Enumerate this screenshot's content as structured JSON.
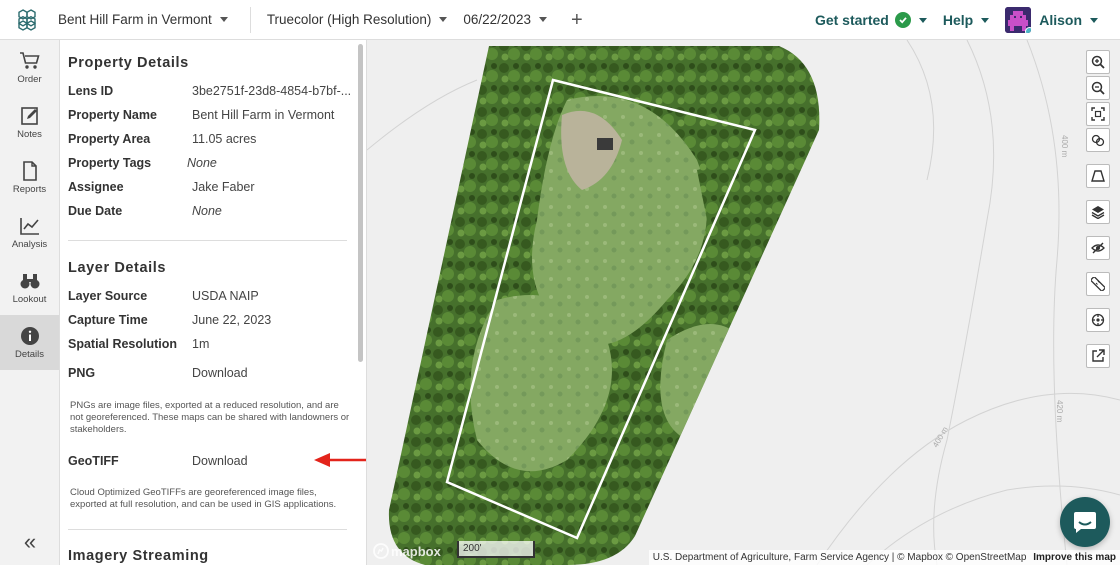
{
  "topbar": {
    "property_name": "Bent Hill Farm in Vermont",
    "layer": "Truecolor (High Resolution)",
    "date": "06/22/2023",
    "add_label": "+",
    "get_started": "Get started",
    "help": "Help",
    "user_name": "Alison"
  },
  "rail": {
    "items": [
      {
        "label": "Order",
        "icon": "cart-icon"
      },
      {
        "label": "Notes",
        "icon": "notes-icon"
      },
      {
        "label": "Reports",
        "icon": "document-icon"
      },
      {
        "label": "Analysis",
        "icon": "chart-line-icon"
      },
      {
        "label": "Lookout",
        "icon": "binoculars-icon"
      },
      {
        "label": "Details",
        "icon": "info-icon"
      }
    ],
    "collapse": "«"
  },
  "property_details": {
    "title": "Property Details",
    "rows": [
      {
        "key": "Lens ID",
        "value": "3be2751f-23d8-4854-b7bf-..."
      },
      {
        "key": "Property Name",
        "value": "Bent Hill Farm in Vermont"
      },
      {
        "key": "Property Area",
        "value": "11.05 acres"
      },
      {
        "key": "Property Tags",
        "value": "None"
      },
      {
        "key": "Assignee",
        "value": "Jake Faber"
      },
      {
        "key": "Due Date",
        "value": "None"
      }
    ]
  },
  "layer_details": {
    "title": "Layer Details",
    "rows": [
      {
        "key": "Layer Source",
        "value": "USDA NAIP"
      },
      {
        "key": "Capture Time",
        "value": "June 22, 2023"
      },
      {
        "key": "Spatial Resolution",
        "value": "1m"
      }
    ],
    "png": {
      "key": "PNG",
      "link": "Download",
      "note": "PNGs are image files, exported at a reduced resolution, and are not georeferenced. These maps can be shared with landowners or stakeholders."
    },
    "geotiff": {
      "key": "GeoTIFF",
      "link": "Download",
      "note": "Cloud Optimized GeoTIFFs are georeferenced image files, exported at full resolution, and can be used in GIS applications."
    }
  },
  "imagery_streaming": {
    "title": "Imagery Streaming"
  },
  "map": {
    "scale_label": "200'",
    "mapbox_label": "mapbox",
    "attribution": "U.S. Department of Agriculture, Farm Service Agency | © Mapbox © OpenStreetMap",
    "improve": "Improve this map",
    "contour_labels": [
      "400 m",
      "420 m",
      "400 m"
    ],
    "tools": [
      "zoom-in-icon",
      "zoom-out-icon",
      "fit-bounds-icon",
      "compare-icon",
      "perspective-icon",
      "layers-icon",
      "hide-icon",
      "ruler-icon",
      "crosshair-icon",
      "external-link-icon"
    ]
  },
  "colors": {
    "accent": "#1d5a5c",
    "arrow": "#e3241b",
    "forest": "#3f6b28",
    "field": "#7fa45a"
  }
}
